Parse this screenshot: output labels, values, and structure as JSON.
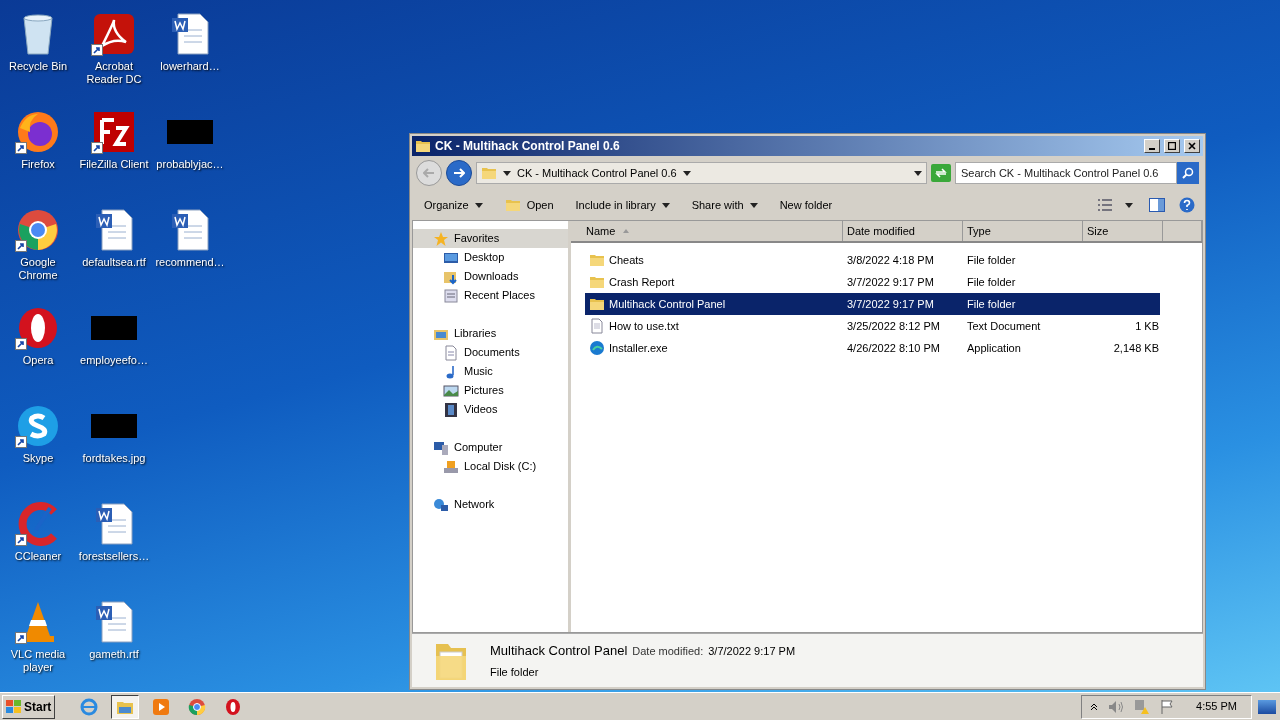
{
  "desktop_icons": [
    {
      "label": "Recycle Bin",
      "kind": "recycle",
      "shortcut": false
    },
    {
      "label": "Firefox",
      "kind": "firefox",
      "shortcut": true
    },
    {
      "label": "Google Chrome",
      "kind": "chrome",
      "shortcut": true
    },
    {
      "label": "Opera",
      "kind": "opera",
      "shortcut": true
    },
    {
      "label": "Skype",
      "kind": "skype",
      "shortcut": true
    },
    {
      "label": "CCleaner",
      "kind": "ccleaner",
      "shortcut": true
    },
    {
      "label": "VLC media player",
      "kind": "vlc",
      "shortcut": true
    },
    {
      "label": "Acrobat Reader DC",
      "kind": "acrobat",
      "shortcut": true
    },
    {
      "label": "FileZilla Client",
      "kind": "filezilla",
      "shortcut": true
    },
    {
      "label": "defaultsea.rtf",
      "kind": "word",
      "shortcut": false
    },
    {
      "label": "employeefo…",
      "kind": "blank",
      "shortcut": false
    },
    {
      "label": "fordtakes.jpg",
      "kind": "blank",
      "shortcut": false
    },
    {
      "label": "forestsellers…",
      "kind": "word",
      "shortcut": false
    },
    {
      "label": "gameth.rtf",
      "kind": "word",
      "shortcut": false
    },
    {
      "label": "lowerhard…",
      "kind": "word",
      "shortcut": false
    },
    {
      "label": "probablyjac…",
      "kind": "blank",
      "shortcut": false
    },
    {
      "label": "recommend…",
      "kind": "word",
      "shortcut": false
    }
  ],
  "window": {
    "title": "CK - Multihack Control Panel 0.6",
    "address": "CK - Multihack Control Panel 0.6",
    "search": {
      "placeholder": "Search CK - Multihack Control Panel 0.6"
    },
    "toolbar": [
      {
        "label": "Organize",
        "kind": "menu"
      },
      {
        "label": "Open",
        "kind": "open"
      },
      {
        "label": "Include in library",
        "kind": "menu"
      },
      {
        "label": "Share with",
        "kind": "menu"
      },
      {
        "label": "New folder",
        "kind": "button"
      }
    ],
    "nav_pane": [
      {
        "label": "Favorites",
        "kind": "star",
        "selected": true,
        "children": [
          {
            "label": "Desktop",
            "kind": "desktop",
            "selected": false
          },
          {
            "label": "Downloads",
            "kind": "downloads",
            "selected": false
          },
          {
            "label": "Recent Places",
            "kind": "recent",
            "selected": false
          }
        ]
      },
      {
        "label": "Libraries",
        "kind": "library",
        "selected": false,
        "children": [
          {
            "label": "Documents",
            "kind": "document",
            "selected": false
          },
          {
            "label": "Music",
            "kind": "music",
            "selected": false
          },
          {
            "label": "Pictures",
            "kind": "pictures",
            "selected": false
          },
          {
            "label": "Videos",
            "kind": "videos",
            "selected": false
          }
        ]
      },
      {
        "label": "Computer",
        "kind": "computer",
        "selected": false,
        "children": [
          {
            "label": "Local Disk (C:)",
            "kind": "disk",
            "selected": false
          }
        ]
      },
      {
        "label": "Network",
        "kind": "network",
        "selected": false
      }
    ],
    "columns": [
      {
        "label": "Name",
        "sorted": true
      },
      {
        "label": "Date modified",
        "sorted": false
      },
      {
        "label": "Type",
        "sorted": false
      },
      {
        "label": "Size",
        "sorted": false
      }
    ],
    "files": [
      {
        "name": "Cheats",
        "kind": "folder",
        "date": "3/8/2022 4:18 PM",
        "type": "File folder",
        "selected": false
      },
      {
        "name": "Crash Report",
        "kind": "folder",
        "date": "3/7/2022 9:17 PM",
        "type": "File folder",
        "selected": false
      },
      {
        "name": "Multihack Control Panel",
        "kind": "folder",
        "date": "3/7/2022 9:17 PM",
        "type": "File folder",
        "selected": true
      },
      {
        "name": "How to use.txt",
        "kind": "text",
        "date": "3/25/2022 8:12 PM",
        "type": "Text Document",
        "size": "1 KB",
        "selected": false
      },
      {
        "name": "Installer.exe",
        "kind": "app",
        "date": "4/26/2022 8:10 PM",
        "type": "Application",
        "size": "2,148 KB",
        "selected": false
      }
    ],
    "details": {
      "name": "Multihack Control Panel",
      "date_label": "Date modified:",
      "date": "3/7/2022 9:17 PM",
      "type": "File folder"
    }
  },
  "taskbar": {
    "start": "Start",
    "apps": [
      {
        "kind": "ie",
        "active": false
      },
      {
        "kind": "explorer",
        "active": true
      },
      {
        "kind": "media",
        "active": false
      },
      {
        "kind": "chrome",
        "active": false
      },
      {
        "kind": "opera",
        "active": false
      }
    ],
    "clock": "4:55 PM"
  }
}
